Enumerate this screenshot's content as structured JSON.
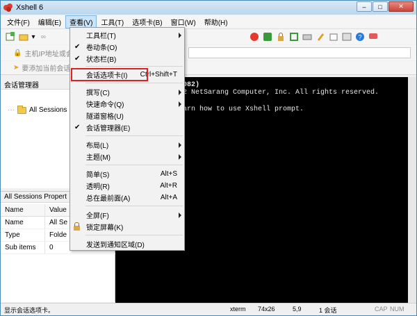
{
  "window": {
    "title": "Xshell 6"
  },
  "menubar": [
    {
      "label": "文件(F)"
    },
    {
      "label": "编辑(E)"
    },
    {
      "label": "查看(V)"
    },
    {
      "label": "工具(T)"
    },
    {
      "label": "选项卡(B)"
    },
    {
      "label": "窗口(W)"
    },
    {
      "label": "帮助(H)"
    }
  ],
  "toolbar": {
    "address_hint": "主机IP地址或会",
    "add_hint": "要添加当前会话"
  },
  "session_manager": {
    "title": "会话管理器",
    "tree_item": "All Sessions"
  },
  "properties": {
    "title": "All Sessions Propert",
    "columns": [
      "Name",
      "Value"
    ],
    "rows": [
      {
        "name": "Name",
        "value": "All Se"
      },
      {
        "name": "Type",
        "value": "Folde"
      },
      {
        "name": "Sub items",
        "value": "0"
      }
    ]
  },
  "terminal": {
    "lines": [
      "082)",
      "2 NetSarang Computer, Inc. All rights reserved.",
      "arn how to use Xshell prompt."
    ]
  },
  "view_menu": {
    "items": [
      {
        "label": "工具栏(T)",
        "shortcut": "",
        "checked": false,
        "submenu": true
      },
      {
        "label": "卷动条(O)",
        "shortcut": "",
        "checked": true,
        "submenu": false
      },
      {
        "label": "状态栏(B)",
        "shortcut": "",
        "checked": true,
        "submenu": false
      },
      {
        "label": "会话选项卡(I)",
        "shortcut": "Ctrl+Shift+T",
        "checked": false,
        "submenu": false
      },
      {
        "label": "撰写(C)",
        "shortcut": "",
        "checked": false,
        "submenu": true
      },
      {
        "label": "快速命令(Q)",
        "shortcut": "",
        "checked": false,
        "submenu": true
      },
      {
        "label": "隧道窗格(U)",
        "shortcut": "",
        "checked": false,
        "submenu": false
      },
      {
        "label": "会话管理器(E)",
        "shortcut": "",
        "checked": true,
        "submenu": false
      },
      {
        "label": "布局(L)",
        "shortcut": "",
        "checked": false,
        "submenu": true
      },
      {
        "label": "主题(M)",
        "shortcut": "",
        "checked": false,
        "submenu": true
      },
      {
        "label": "简单(S)",
        "shortcut": "Alt+S",
        "checked": false,
        "submenu": false
      },
      {
        "label": "透明(R)",
        "shortcut": "Alt+R",
        "checked": false,
        "submenu": false
      },
      {
        "label": "总在最前面(A)",
        "shortcut": "Alt+A",
        "checked": false,
        "submenu": false
      },
      {
        "label": "全屏(F)",
        "shortcut": "",
        "checked": false,
        "submenu": true
      },
      {
        "label": "锁定屏幕(K)",
        "shortcut": "",
        "checked": false,
        "submenu": false
      },
      {
        "label": "发送到通知区域(D)",
        "shortcut": "",
        "checked": false,
        "submenu": false
      }
    ]
  },
  "statusbar": {
    "message": "显示会话选项卡。",
    "terminal_type": "xterm",
    "size": "74x26",
    "cursor": "5,9",
    "sessions": "1 会话",
    "caps": "CAP",
    "num": "NUM"
  },
  "colors": {
    "highlight_box": "#e02020",
    "menu_active": "#cce4f7"
  }
}
